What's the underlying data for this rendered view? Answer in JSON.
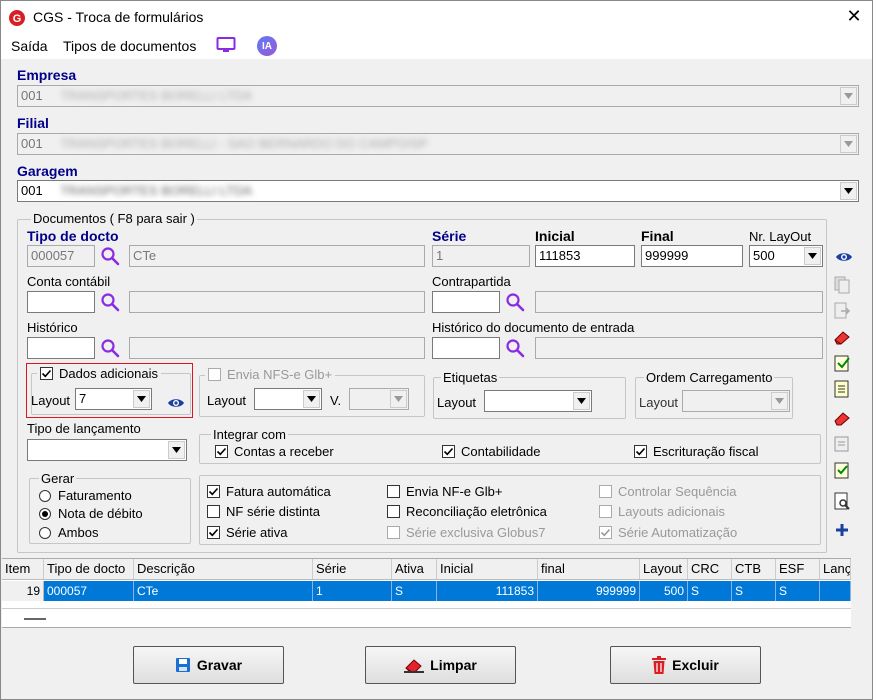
{
  "window": {
    "title": "CGS - Troca de formulários",
    "close": "✕"
  },
  "menu": {
    "saida": "Saída",
    "tipos": "Tipos de documentos",
    "ia": "IA"
  },
  "empresa": {
    "label": "Empresa",
    "value": "001",
    "name": "TRANSPORTES BORELLI LTDA"
  },
  "filial": {
    "label": "Filial",
    "value": "001",
    "name": "TRANSPORTES BORELLI - SAO BERNARDO DO CAMPO/SP"
  },
  "garagem": {
    "label": "Garagem",
    "value": "001",
    "name": "TRANSPORTES BORELLI LTDA"
  },
  "documentos": {
    "group_title": "Documentos ( F8 para sair )",
    "tipo_docto_label": "Tipo de docto",
    "tipo_docto_code": "000057",
    "tipo_docto_desc": "CTe",
    "serie_label": "Série",
    "serie_value": "1",
    "inicial_label": "Inicial",
    "inicial_value": "111853",
    "final_label": "Final",
    "final_value": "999999",
    "nr_layout_label": "Nr. LayOut",
    "nr_layout_value": "500",
    "conta_contabil_label": "Conta contábil",
    "contrapartida_label": "Contrapartida",
    "historico_label": "Histórico",
    "historico_entrada_label": "Histórico do documento de entrada",
    "dados_adicionais": {
      "label": "Dados adicionais",
      "checked": true,
      "layout_label": "Layout",
      "layout_value": "7"
    },
    "envia_nfse": {
      "label": "Envia NFS-e Glb+",
      "checked": false,
      "layout_label": "Layout",
      "v_label": "V."
    },
    "etiquetas": {
      "title": "Etiquetas",
      "layout_label": "Layout"
    },
    "ordem_carregamento": {
      "title": "Ordem Carregamento",
      "layout_label": "Layout"
    },
    "tipo_lancamento_label": "Tipo de lançamento",
    "integrar": {
      "title": "Integrar com",
      "contas_receber": "Contas a receber",
      "contabilidade": "Contabilidade",
      "escrituracao": "Escrituração fiscal"
    },
    "gerar": {
      "title": "Gerar",
      "faturamento": "Faturamento",
      "nota_debito": "Nota de débito",
      "ambos": "Ambos",
      "selected": "Nota de débito"
    },
    "opts": {
      "fatura_automatica": "Fatura automática",
      "nf_serie_distinta": "NF série distinta",
      "serie_ativa": "Série ativa",
      "envia_nfe": "Envia NF-e Glb+",
      "reconciliacao": "Reconciliação eletrônica",
      "serie_exclusiva": "Série exclusiva Globus7",
      "controlar_sequencia": "Controlar Sequência",
      "layouts_adicionais": "Layouts adicionais",
      "serie_automatizacao": "Série Automatização"
    }
  },
  "table": {
    "headers": [
      "Item",
      "Tipo de docto",
      "Descrição",
      "Série",
      "Ativa",
      "Inicial",
      "final",
      "Layout",
      "CRC",
      "CTB",
      "ESF",
      "Lanç"
    ],
    "rows": [
      [
        "19",
        "000057",
        "CTe",
        "1",
        "S",
        "111853",
        "999999",
        "500",
        "S",
        "S",
        "S",
        ""
      ]
    ]
  },
  "buttons": {
    "gravar": "Gravar",
    "limpar": "Limpar",
    "excluir": "Excluir"
  },
  "colors": {
    "label_blue": "#00008b",
    "selection": "#0078d7",
    "highlight_border": "#e0141e",
    "eye": "#1a3fa0"
  }
}
